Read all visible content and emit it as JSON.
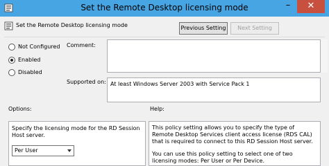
{
  "window": {
    "title": "Set the Remote Desktop licensing mode",
    "close_glyph": "✕",
    "minimize_glyph": "–"
  },
  "header": {
    "policy_name": "Set the Remote Desktop licensing mode",
    "previous_setting_label": "Previous Setting",
    "next_setting_label": "Next Setting"
  },
  "state": {
    "options": [
      {
        "label": "Not Configured",
        "selected": false
      },
      {
        "label": "Enabled",
        "selected": true
      },
      {
        "label": "Disabled",
        "selected": false
      }
    ]
  },
  "comment": {
    "label": "Comment:",
    "value": ""
  },
  "supported": {
    "label": "Supported on:",
    "value": "At least Windows Server 2003 with Service Pack 1"
  },
  "options_panel": {
    "heading": "Options:",
    "description": "Specify the licensing mode for the RD Session Host server.",
    "mode_selected": "Per User"
  },
  "help_panel": {
    "heading": "Help:",
    "paragraph1": "This policy setting allows you to specify the type of Remote Desktop Services client access license (RDS CAL) that is required to connect to this RD Session Host server.",
    "paragraph2": "You can use this policy setting to select one of two licensing modes: Per User or Per Device."
  },
  "icons": {
    "title_icon": "policy-setting-icon",
    "header_icon": "policy-setting-icon"
  }
}
